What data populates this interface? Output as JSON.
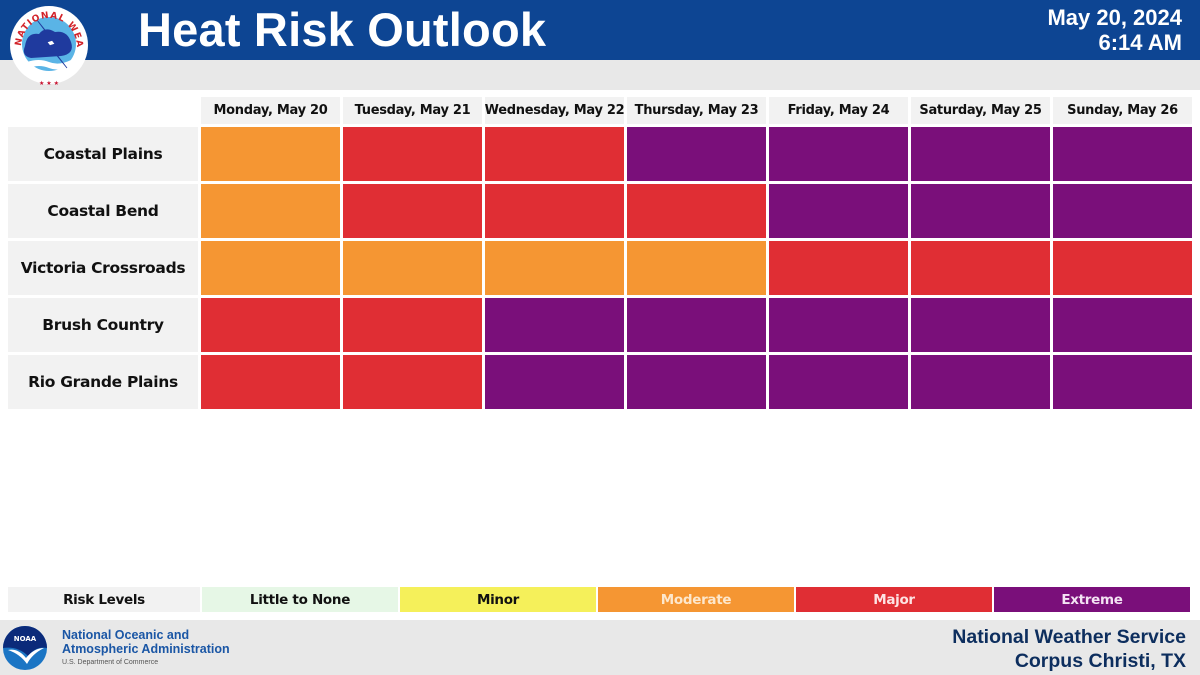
{
  "header": {
    "title": "Heat Risk Outlook",
    "date": "May 20, 2024",
    "time": "6:14 AM",
    "logo_icon": "nws-logo-icon",
    "logo_text": "NATIONAL WEATHER SERVICE"
  },
  "colors": {
    "header_bg": "#0d4593",
    "label_bg": "#f2f2f2",
    "little_to_none": "#e6f7e6",
    "minor": "#f5f05a",
    "moderate": "#f59633",
    "major": "#e02e34",
    "extreme": "#7a0f7a"
  },
  "chart_data": {
    "type": "heatmap",
    "title": "Heat Risk Outlook",
    "columns": [
      "Monday, May 20",
      "Tuesday, May 21",
      "Wednesday, May 22",
      "Thursday, May 23",
      "Friday, May 24",
      "Saturday, May 25",
      "Sunday, May 26"
    ],
    "rows": [
      "Coastal Plains",
      "Coastal Bend",
      "Victoria Crossroads",
      "Brush Country",
      "Rio Grande Plains"
    ],
    "levels": [
      "Little to None",
      "Minor",
      "Moderate",
      "Major",
      "Extreme"
    ],
    "values": [
      [
        "Moderate",
        "Major",
        "Major",
        "Extreme",
        "Extreme",
        "Extreme",
        "Extreme"
      ],
      [
        "Moderate",
        "Major",
        "Major",
        "Major",
        "Extreme",
        "Extreme",
        "Extreme"
      ],
      [
        "Moderate",
        "Moderate",
        "Moderate",
        "Moderate",
        "Major",
        "Major",
        "Major"
      ],
      [
        "Major",
        "Major",
        "Extreme",
        "Extreme",
        "Extreme",
        "Extreme",
        "Extreme"
      ],
      [
        "Major",
        "Major",
        "Extreme",
        "Extreme",
        "Extreme",
        "Extreme",
        "Extreme"
      ]
    ]
  },
  "legend": {
    "title": "Risk Levels",
    "items": [
      {
        "label": "Little to None",
        "color": "#e6f7e6",
        "text_color": "#111111"
      },
      {
        "label": "Minor",
        "color": "#f5f05a",
        "text_color": "#111111"
      },
      {
        "label": "Moderate",
        "color": "#f59633",
        "text_color": "#fde7cc"
      },
      {
        "label": "Major",
        "color": "#e02e34",
        "text_color": "#fde3e3"
      },
      {
        "label": "Extreme",
        "color": "#7a0f7a",
        "text_color": "#f3e3f3"
      }
    ]
  },
  "footer": {
    "noaa_line1": "National Oceanic and",
    "noaa_line2": "Atmospheric Administration",
    "noaa_sub": "U.S. Department of Commerce",
    "noaa_logo_text": "NOAA",
    "nws_line1": "National Weather Service",
    "nws_line2": "Corpus Christi, TX"
  }
}
